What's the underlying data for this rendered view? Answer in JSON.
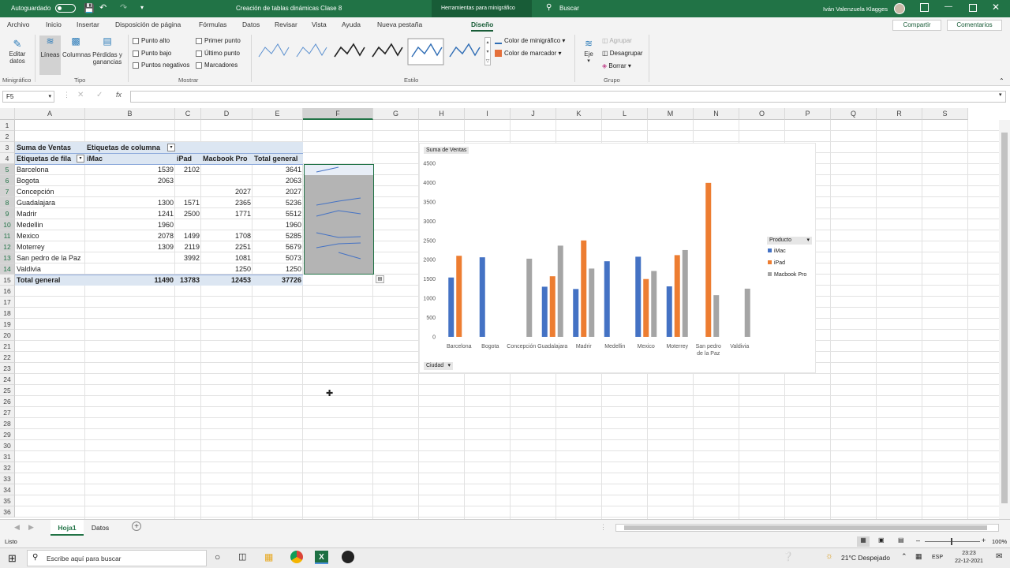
{
  "titlebar": {
    "autosave": "Autoguardado",
    "doc_title": "Creación de tablas dinámicas Clase 8",
    "context_tab": "Herramientas para minigráfico",
    "search_label": "Buscar",
    "user_name": "Iván Valenzuela Klagges"
  },
  "ribbon_tabs": [
    "Archivo",
    "Inicio",
    "Insertar",
    "Disposición de página",
    "Fórmulas",
    "Datos",
    "Revisar",
    "Vista",
    "Ayuda",
    "Nueva pestaña",
    "Diseño"
  ],
  "share_label": "Compartir",
  "comments_label": "Comentarios",
  "ribbon": {
    "edit_data": "Editar datos",
    "group_sparkline": "Minigráfico",
    "type_lines": "Líneas",
    "type_columns": "Columnas",
    "type_winloss": "Pérdidas y ganancias",
    "group_type": "Tipo",
    "show": [
      "Punto alto",
      "Punto bajo",
      "Puntos negativos",
      "Primer punto",
      "Último punto",
      "Marcadores"
    ],
    "group_show": "Mostrar",
    "sparkline_color": "Color de minigráfico",
    "marker_color": "Color de marcador",
    "group_style": "Estilo",
    "axis": "Eje",
    "group_btn": "Agrupar",
    "ungroup_btn": "Desagrupar",
    "clear_btn": "Borrar",
    "group_group": "Grupo"
  },
  "namebox": "F5",
  "columns": [
    "A",
    "B",
    "C",
    "D",
    "E",
    "F",
    "G",
    "H",
    "I",
    "J",
    "K",
    "L",
    "M",
    "N",
    "O",
    "P",
    "Q",
    "R",
    "S"
  ],
  "pivot": {
    "sum_label": "Suma de Ventas",
    "col_labels": "Etiquetas de columna",
    "row_labels": "Etiquetas de fila",
    "headers": [
      "iMac",
      "iPad",
      "Macbook Pro",
      "Total general"
    ],
    "rows": [
      {
        "city": "Barcelona",
        "imac": "1539",
        "ipad": "2102",
        "mbp": "",
        "total": "3641"
      },
      {
        "city": "Bogota",
        "imac": "2063",
        "ipad": "",
        "mbp": "",
        "total": "2063"
      },
      {
        "city": "Concepción",
        "imac": "",
        "ipad": "",
        "mbp": "2027",
        "total": "2027"
      },
      {
        "city": "Guadalajara",
        "imac": "1300",
        "ipad": "1571",
        "mbp": "2365",
        "total": "5236"
      },
      {
        "city": "Madrir",
        "imac": "1241",
        "ipad": "2500",
        "mbp": "1771",
        "total": "5512"
      },
      {
        "city": "Medellin",
        "imac": "1960",
        "ipad": "",
        "mbp": "",
        "total": "1960"
      },
      {
        "city": "Mexico",
        "imac": "2078",
        "ipad": "1499",
        "mbp": "1708",
        "total": "5285"
      },
      {
        "city": "Moterrey",
        "imac": "1309",
        "ipad": "2119",
        "mbp": "2251",
        "total": "5679"
      },
      {
        "city": "San pedro de la Paz",
        "imac": "",
        "ipad": "3992",
        "mbp": "1081",
        "total": "5073"
      },
      {
        "city": "Valdivia",
        "imac": "",
        "ipad": "",
        "mbp": "1250",
        "total": "1250"
      }
    ],
    "total": {
      "label": "Total general",
      "imac": "11490",
      "ipad": "13783",
      "mbp": "12453",
      "total": "37726"
    }
  },
  "chart_data": {
    "type": "bar",
    "title": "Suma de Ventas",
    "categories": [
      "Barcelona",
      "Bogota",
      "Concepción",
      "Guadalajara",
      "Madrir",
      "Medellin",
      "Mexico",
      "Moterrey",
      "San pedro de la Paz",
      "Valdivia"
    ],
    "category_lines": [
      [
        "Barcelona"
      ],
      [
        "Bogota"
      ],
      [
        "Concepción"
      ],
      [
        "Guadalajara"
      ],
      [
        "Madrir"
      ],
      [
        "Medellin"
      ],
      [
        "Mexico"
      ],
      [
        "Moterrey"
      ],
      [
        "San pedro",
        "de la Paz"
      ],
      [
        "Valdivia"
      ]
    ],
    "series": [
      {
        "name": "iMac",
        "color": "#4472c4",
        "values": [
          1539,
          2063,
          null,
          1300,
          1241,
          1960,
          2078,
          1309,
          null,
          null
        ]
      },
      {
        "name": "iPad",
        "color": "#ed7d31",
        "values": [
          2102,
          null,
          null,
          1571,
          2500,
          null,
          1499,
          2119,
          3992,
          null
        ]
      },
      {
        "name": "Macbook Pro",
        "color": "#a5a5a5",
        "values": [
          null,
          null,
          2027,
          2365,
          1771,
          null,
          1708,
          2251,
          1081,
          1250
        ]
      }
    ],
    "ylim": [
      0,
      4500
    ],
    "yticks": [
      "0",
      "500",
      "1000",
      "1500",
      "2000",
      "2500",
      "3000",
      "3500",
      "4000",
      "4500"
    ],
    "legend_title": "Producto",
    "axis_field": "Ciudad",
    "grid": false,
    "legend_position": "right"
  },
  "sheets": [
    "Hoja1",
    "Datos"
  ],
  "status": "Listo",
  "zoom": "100%",
  "taskbar": {
    "search": "Escribe aquí para buscar",
    "weather": "21°C  Despejado",
    "lang": "ESP",
    "time": "23:23",
    "date": "22-12-2021"
  }
}
